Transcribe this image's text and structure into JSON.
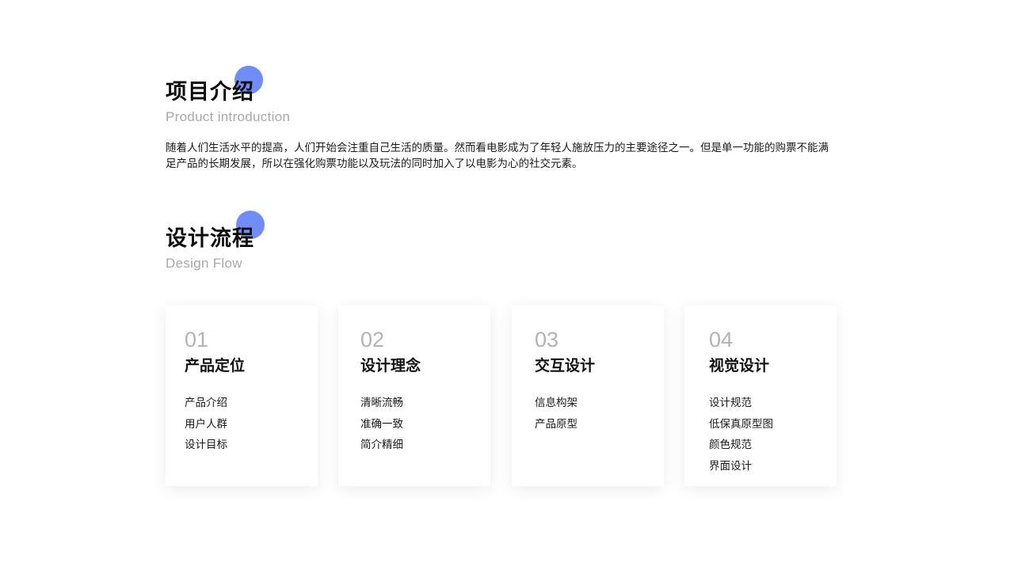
{
  "intro": {
    "title": "项目介绍",
    "subtitle": "Product introduction",
    "body": "随着人们生活水平的提高，人们开始会注重自己生活的质量。然而看电影成为了年轻人施放压力的主要途径之一。但是单一功能的购票不能满足产品的长期发展，所以在强化购票功能以及玩法的同时加入了以电影为心的社交元素。"
  },
  "design_flow": {
    "title": "设计流程",
    "subtitle": "Design Flow",
    "cards": [
      {
        "number": "01",
        "title": "产品定位",
        "items": [
          "产品介绍",
          "用户人群",
          "设计目标"
        ]
      },
      {
        "number": "02",
        "title": "设计理念",
        "items": [
          "清晰流畅",
          "准确一致",
          "简介精细"
        ]
      },
      {
        "number": "03",
        "title": "交互设计",
        "items": [
          "信息构架",
          "产品原型"
        ]
      },
      {
        "number": "04",
        "title": "视觉设计",
        "items": [
          "设计规范",
          "低保真原型图",
          "颜色规范",
          "界面设计"
        ]
      }
    ]
  },
  "colors": {
    "accent_dot": "#5b7cf6",
    "number_gray": "#b3b3b3",
    "subtitle_gray": "#a8a8a8"
  }
}
